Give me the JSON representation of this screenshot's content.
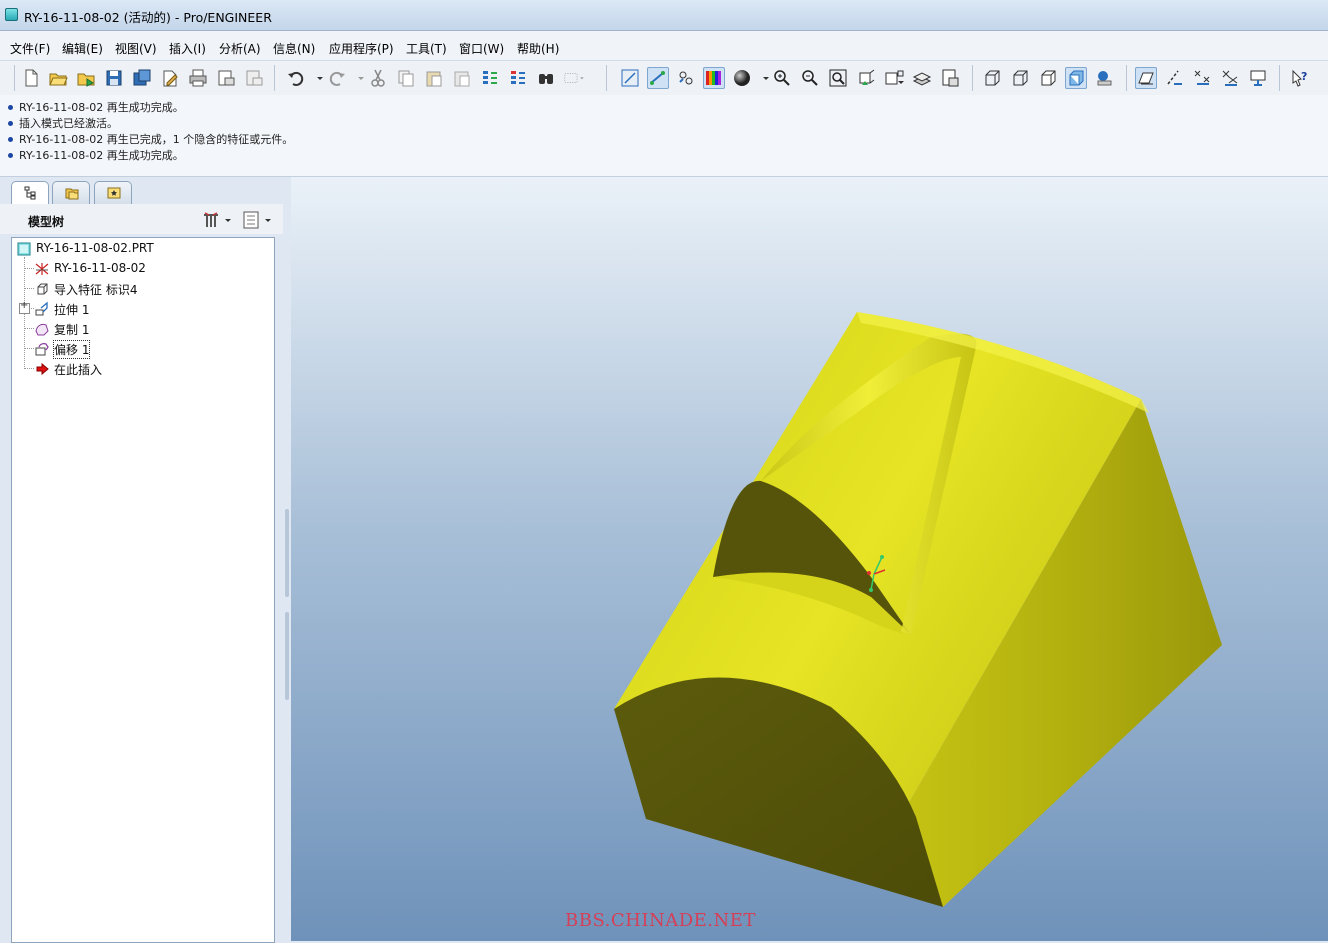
{
  "window": {
    "title": "RY-16-11-08-02 (活动的) - Pro/ENGINEER"
  },
  "menu": [
    "文件(F)",
    "编辑(E)",
    "视图(V)",
    "插入(I)",
    "分析(A)",
    "信息(N)",
    "应用程序(P)",
    "工具(T)",
    "窗口(W)",
    "帮助(H)"
  ],
  "messages": [
    "RY-16-11-08-02 再生成功完成。",
    "插入模式已经激活。",
    "RY-16-11-08-02 再生已完成，1 个隐含的特征或元件。",
    "RY-16-11-08-02 再生成功完成。"
  ],
  "model_tree": {
    "title": "模型树",
    "root": "RY-16-11-08-02.PRT",
    "nodes": [
      "RY-16-11-08-02",
      "导入特征 标识4",
      "拉伸 1",
      "复制 1",
      "偏移 1",
      "在此插入"
    ]
  },
  "watermark": "BBS.CHINADE.NET",
  "colors": {
    "model_yellow": "#d8d81c",
    "model_shadow": "#55540a",
    "viewport_top": "#eaf1f8",
    "viewport_bottom": "#6f92ba"
  }
}
